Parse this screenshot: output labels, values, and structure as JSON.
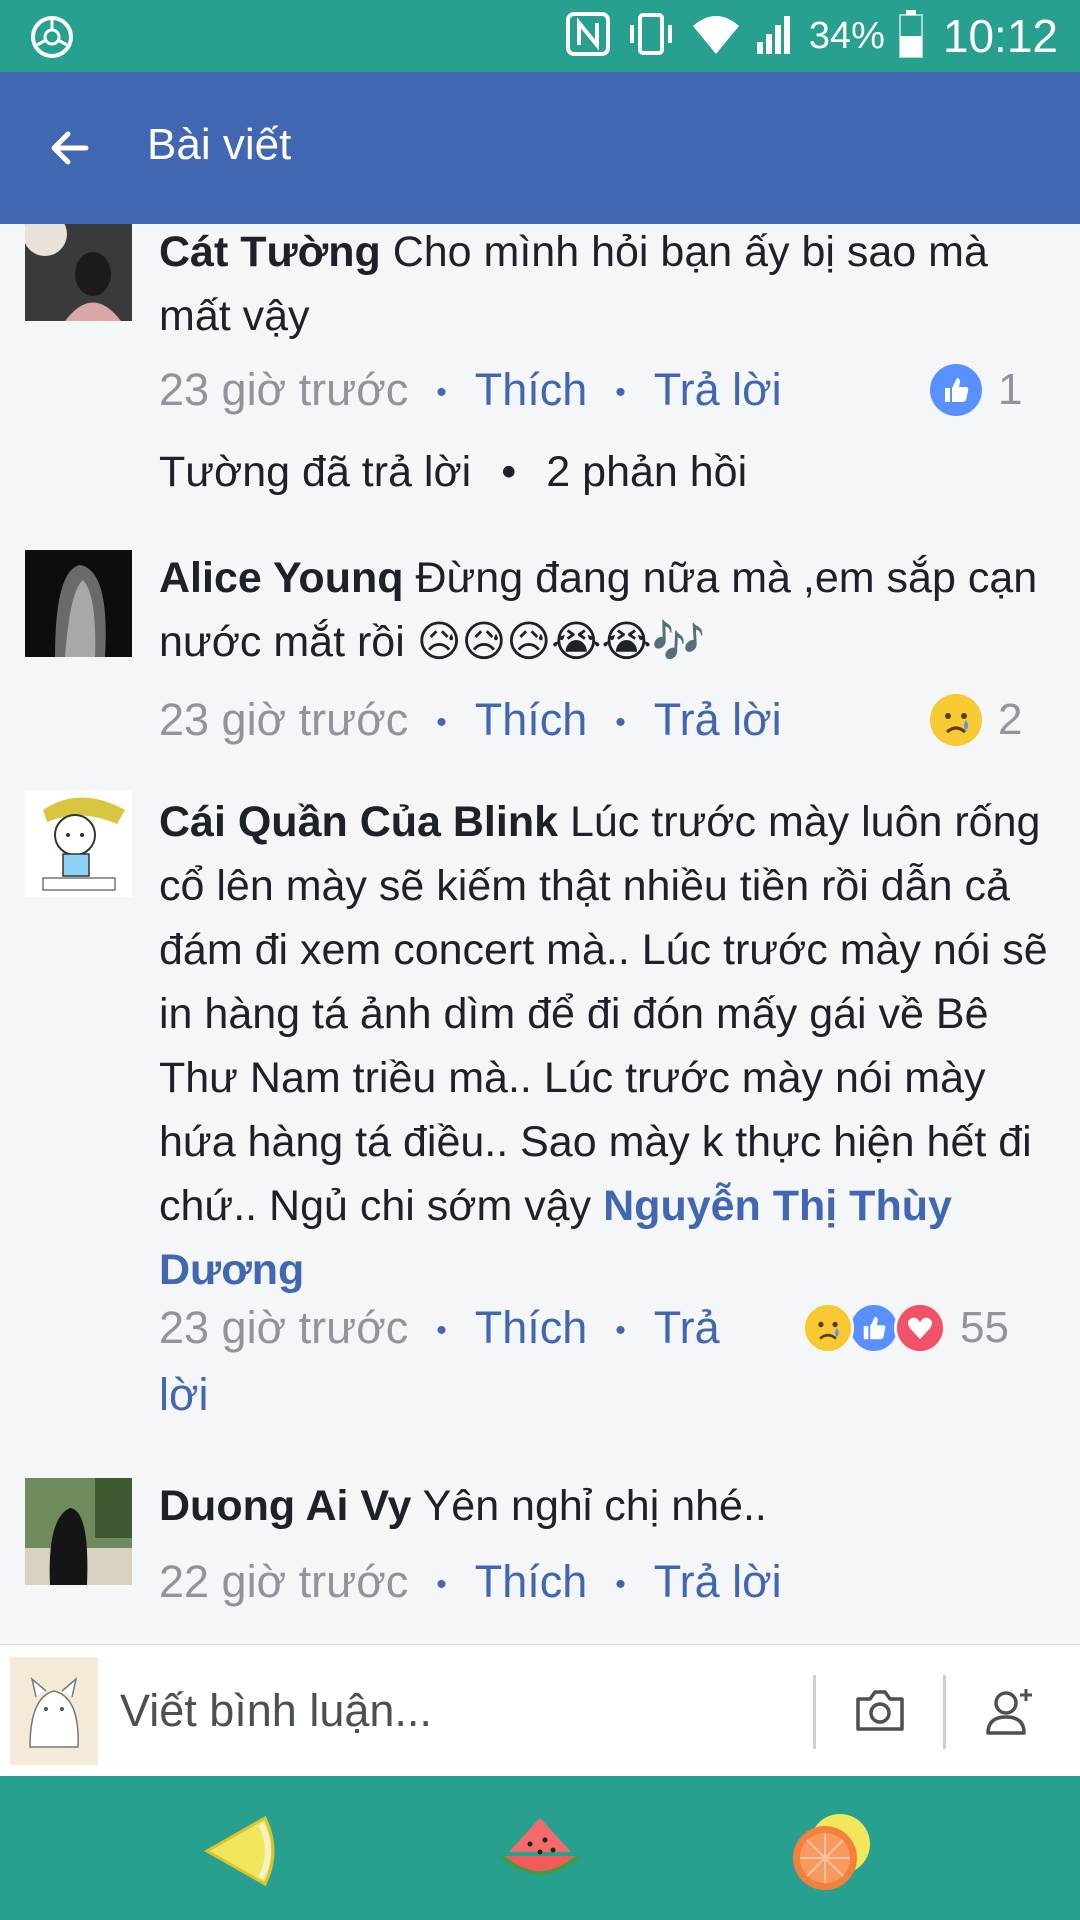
{
  "status_bar": {
    "battery": "34%",
    "time": "10:12"
  },
  "header": {
    "title": "Bài viết"
  },
  "comments": [
    {
      "name": "Cát Tường",
      "text": "Cho mình hỏi bạn ấy bị sao mà mất vậy",
      "time": "23 giờ trước",
      "like": "Thích",
      "reply": "Trả lời",
      "reaction_count": "1",
      "replies_author": "Tường đã trả lời",
      "replies_count": "2 phản hồi"
    },
    {
      "name": "Alice Younq",
      "text": "Đừng đang nữa mà ,em sắp cạn nước mắt rồi 😥😥😥😭😭🎶",
      "time": "23 giờ trước",
      "like": "Thích",
      "reply": "Trả lời",
      "reaction_count": "2"
    },
    {
      "name": "Cái Quần Của Blink",
      "text": "Lúc trước mày luôn rống cổ lên mày sẽ kiếm thật nhiều tiền rồi dẫn cả đám đi xem concert mà.. Lúc trước mày nói sẽ in hàng tá ảnh dìm để đi đón mấy gái về Bê Thư Nam triều mà.. Lúc trước mày nói mày hứa hàng tá điều.. Sao mày k thực hiện hết đi chứ.. Ngủ chi sớm vậy",
      "mention": "Nguyễn Thị Thùy Dương",
      "time": "23 giờ trước",
      "like": "Thích",
      "reply": "Trả lời",
      "reaction_count": "55"
    },
    {
      "name": "Duong Ai Vy",
      "text": "Yên nghỉ chị nhé..",
      "time": "22 giờ trước",
      "like": "Thích",
      "reply": "Trả lời"
    }
  ],
  "composer": {
    "placeholder": "Viết bình luận..."
  },
  "colors": {
    "status_bar": "#27a08f",
    "header": "#4267b2",
    "link": "#4267b2",
    "muted": "#90949c"
  }
}
